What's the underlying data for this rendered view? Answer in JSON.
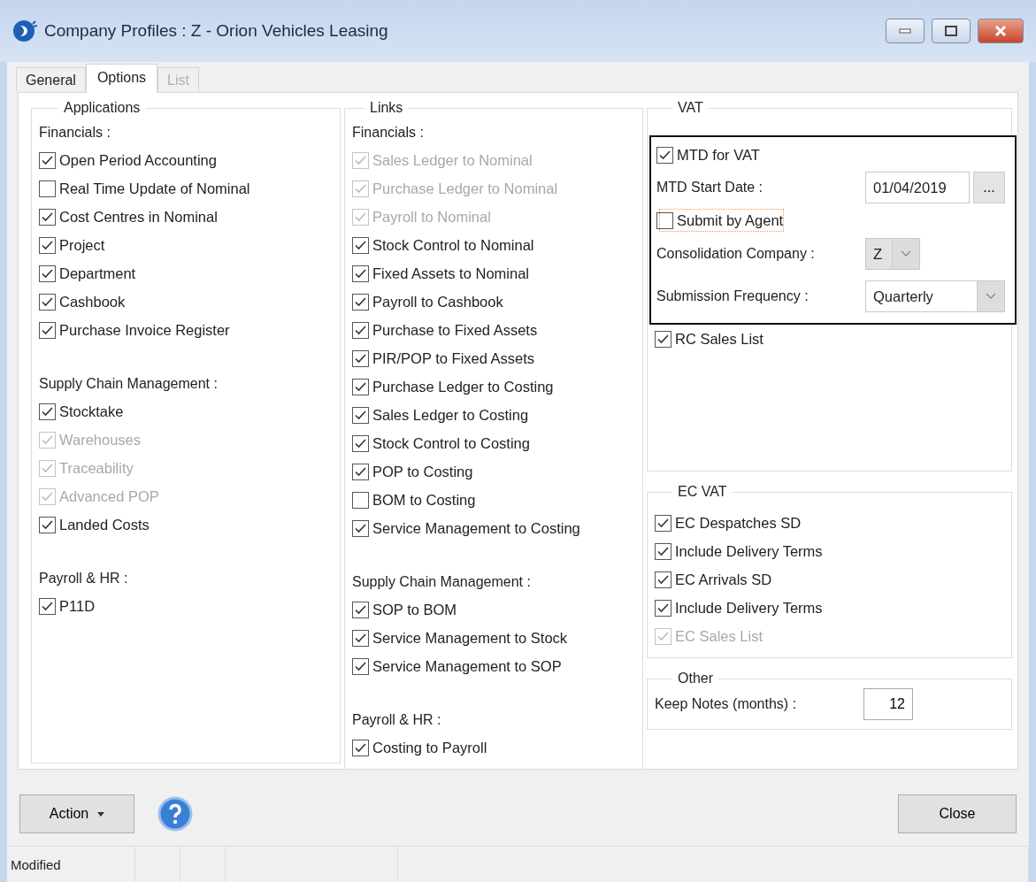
{
  "window": {
    "title": "Company Profiles : Z - Orion Vehicles Leasing"
  },
  "tabs": [
    {
      "label": "General",
      "selected": false,
      "disabled": false
    },
    {
      "label": "Options",
      "selected": true,
      "disabled": false
    },
    {
      "label": "List",
      "selected": false,
      "disabled": true
    }
  ],
  "columns": [
    {
      "title": "Applications",
      "sections": [
        {
          "heading": "Financials :",
          "items": [
            {
              "label": "Open Period Accounting",
              "checked": true,
              "disabled": false
            },
            {
              "label": "Real Time Update of Nominal",
              "checked": false,
              "disabled": false
            },
            {
              "label": "Cost Centres in  Nominal",
              "checked": true,
              "disabled": false
            },
            {
              "label": "Project",
              "checked": true,
              "disabled": false
            },
            {
              "label": "Department",
              "checked": true,
              "disabled": false
            },
            {
              "label": "Cashbook",
              "checked": true,
              "disabled": false
            },
            {
              "label": "Purchase Invoice Register",
              "checked": true,
              "disabled": false
            }
          ]
        },
        {
          "heading": "Supply Chain Management :",
          "items": [
            {
              "label": "Stocktake",
              "checked": true,
              "disabled": false
            },
            {
              "label": "Warehouses",
              "checked": true,
              "disabled": true
            },
            {
              "label": "Traceability",
              "checked": true,
              "disabled": true
            },
            {
              "label": "Advanced POP",
              "checked": true,
              "disabled": true
            },
            {
              "label": "Landed Costs",
              "checked": true,
              "disabled": false
            }
          ]
        },
        {
          "heading": "Payroll & HR :",
          "items": [
            {
              "label": "P11D",
              "checked": true,
              "disabled": false
            }
          ]
        }
      ]
    },
    {
      "title": "Links",
      "sections": [
        {
          "heading": "Financials :",
          "items": [
            {
              "label": "Sales Ledger to Nominal",
              "checked": true,
              "disabled": true
            },
            {
              "label": "Purchase Ledger to Nominal",
              "checked": true,
              "disabled": true
            },
            {
              "label": "Payroll to  Nominal",
              "checked": true,
              "disabled": true
            },
            {
              "label": "Stock Control to Nominal",
              "checked": true,
              "disabled": false
            },
            {
              "label": "Fixed Assets to Nominal",
              "checked": true,
              "disabled": false
            },
            {
              "label": "Payroll to Cashbook",
              "checked": true,
              "disabled": false
            },
            {
              "label": "Purchase to Fixed Assets",
              "checked": true,
              "disabled": false
            },
            {
              "label": "PIR/POP to Fixed Assets",
              "checked": true,
              "disabled": false
            },
            {
              "label": "Purchase Ledger to Costing",
              "checked": true,
              "disabled": false
            },
            {
              "label": "Sales Ledger to Costing",
              "checked": true,
              "disabled": false
            },
            {
              "label": "Stock Control to Costing",
              "checked": true,
              "disabled": false
            },
            {
              "label": "POP to Costing",
              "checked": true,
              "disabled": false
            },
            {
              "label": "BOM to Costing",
              "checked": false,
              "disabled": false
            },
            {
              "label": "Service Management to Costing",
              "checked": true,
              "disabled": false
            }
          ]
        },
        {
          "heading": "Supply Chain Management :",
          "items": [
            {
              "label": "SOP to BOM",
              "checked": true,
              "disabled": false
            },
            {
              "label": "Service Management to Stock",
              "checked": true,
              "disabled": false
            },
            {
              "label": "Service Management to SOP",
              "checked": true,
              "disabled": false
            }
          ]
        },
        {
          "heading": "Payroll & HR :",
          "items": [
            {
              "label": "Costing to Payroll",
              "checked": true,
              "disabled": false
            }
          ]
        }
      ]
    }
  ],
  "vat": {
    "title": "VAT",
    "highlighted": [
      {
        "kind": "checkbox",
        "label": "MTD for VAT",
        "checked": true,
        "focused": false
      },
      {
        "kind": "date",
        "label": "MTD Start Date :",
        "value": "01/04/2019",
        "button": "..."
      },
      {
        "kind": "checkbox",
        "label": "Submit by Agent",
        "checked": false,
        "focused": true
      },
      {
        "kind": "dropdown",
        "label": "Consolidation Company :",
        "value": "Z",
        "disabled": true
      },
      {
        "kind": "dropdown",
        "label": "Submission Frequency :",
        "value": "Quarterly",
        "disabled": false
      }
    ],
    "items": [
      {
        "label": "RC Sales List",
        "checked": true,
        "disabled": false
      }
    ]
  },
  "ec_vat": {
    "title": "EC VAT",
    "items": [
      {
        "label": "EC Despatches SD",
        "checked": true,
        "disabled": false
      },
      {
        "label": "Include Delivery Terms",
        "checked": true,
        "disabled": false
      },
      {
        "label": "EC Arrivals SD",
        "checked": true,
        "disabled": false
      },
      {
        "label": "Include Delivery Terms",
        "checked": true,
        "disabled": false
      },
      {
        "label": "EC Sales List",
        "checked": true,
        "disabled": true
      }
    ]
  },
  "other": {
    "title": "Other",
    "label": "Keep Notes (months) :",
    "value": "12"
  },
  "buttons": {
    "action": "Action",
    "close": "Close"
  },
  "status_bar": [
    "Modified"
  ]
}
